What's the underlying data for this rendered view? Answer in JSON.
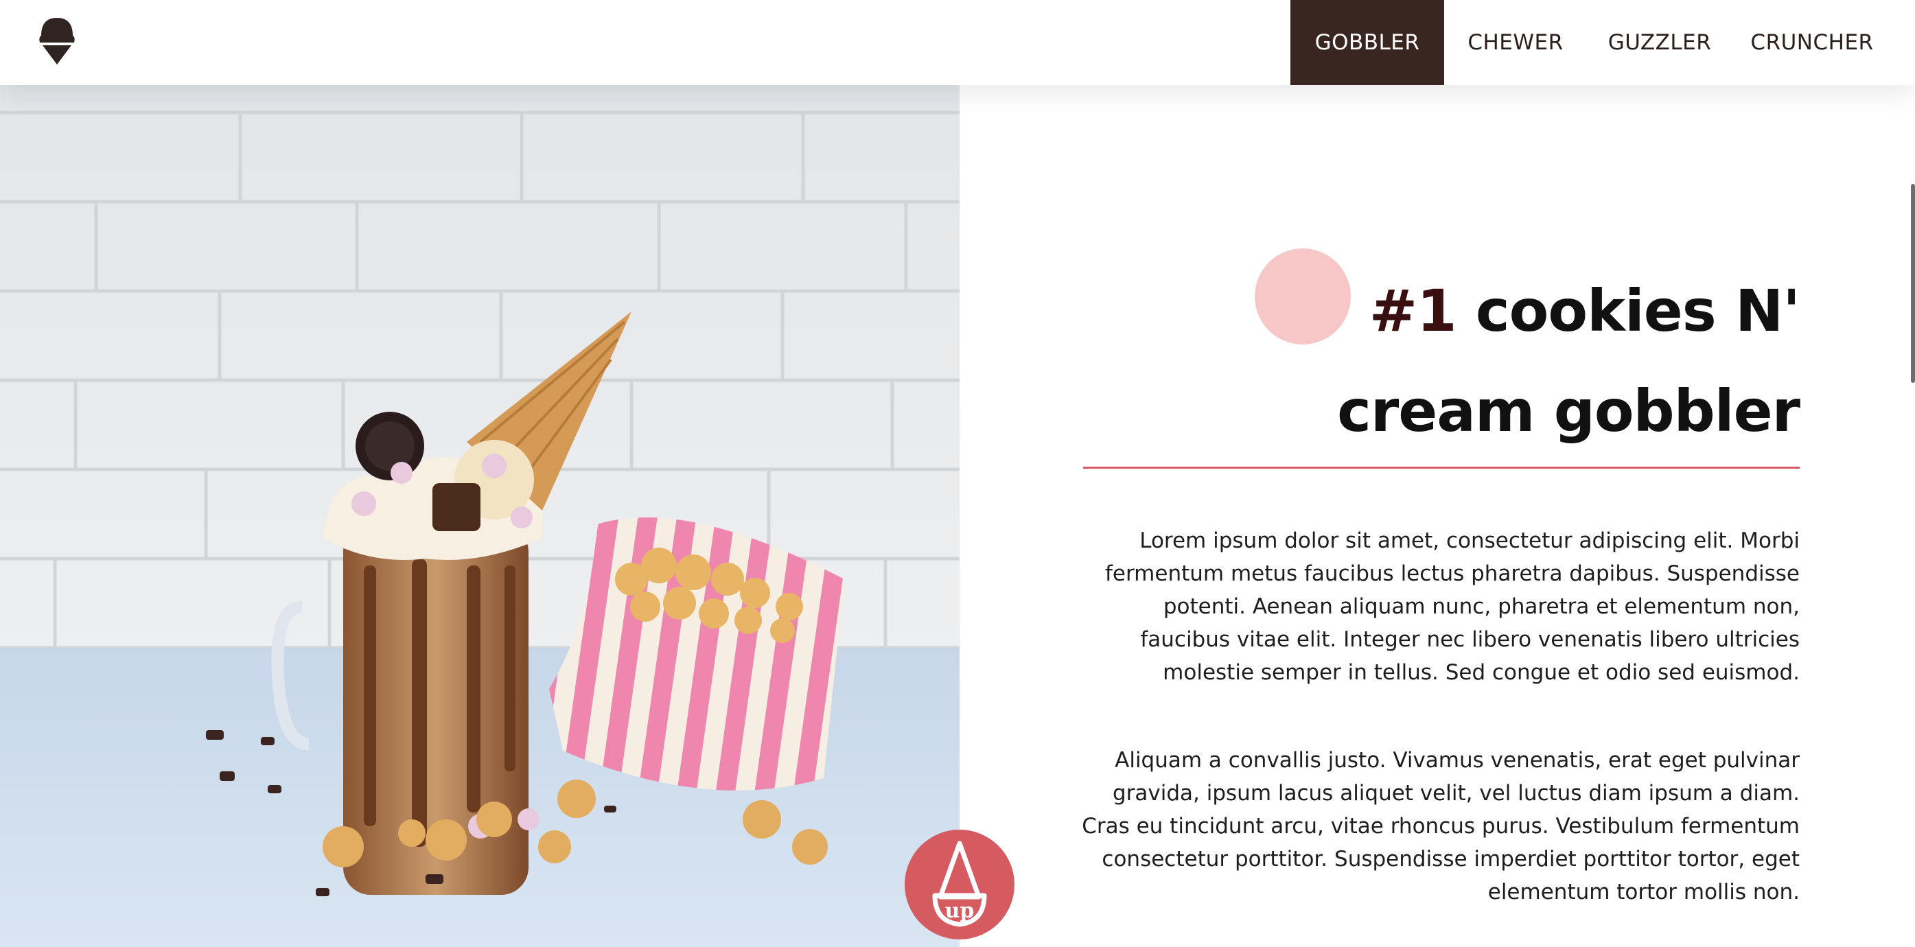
{
  "nav": {
    "items": [
      {
        "label": "GOBBLER",
        "active": true
      },
      {
        "label": "CHEWER",
        "active": false
      },
      {
        "label": "GUZZLER",
        "active": false
      },
      {
        "label": "CRUNCHER",
        "active": false
      }
    ]
  },
  "hero": {
    "image": "freakshake-with-popcorn"
  },
  "article": {
    "title_number": "#1",
    "title_text": "cookies N' cream gobbler",
    "paragraphs": [
      "Lorem ipsum dolor sit amet, consectetur adipiscing elit. Morbi fermentum metus faucibus lectus pharetra dapibus. Suspendisse potenti. Aenean aliquam nunc, pharetra et elementum non, faucibus vitae elit. Integer nec libero venenatis libero ultricies molestie semper in tellus. Sed congue et odio sed euismod.",
      "Aliquam a convallis justo. Vivamus venenatis, erat eget pulvinar gravida, ipsum lacus aliquet velit, vel luctus diam ipsum a diam. Cras eu tincidunt arcu, vitae rhoncus purus. Vestibulum fermentum consectetur porttitor. Suspendisse imperdiet porttitor tortor, eget elementum tortor mollis non."
    ]
  },
  "up_button": {
    "label": "up"
  },
  "colors": {
    "brand_dark": "#3a2621",
    "accent": "#d55b61",
    "accent_light": "#f7c7c7"
  }
}
